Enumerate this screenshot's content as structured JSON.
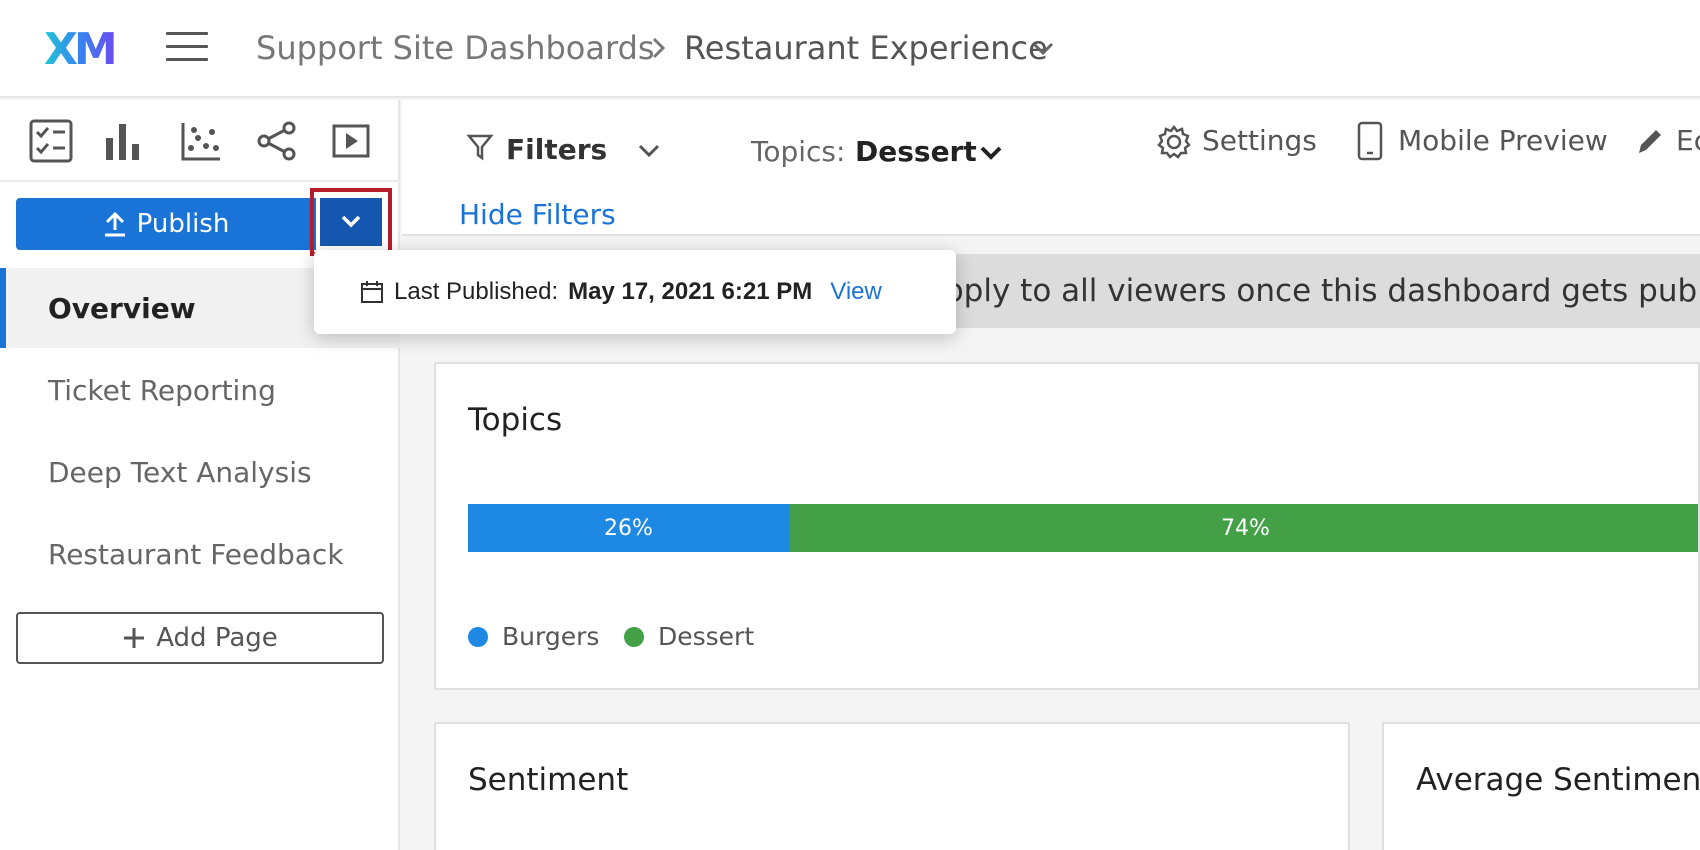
{
  "header": {
    "logo": "XM",
    "breadcrumb_root": "Support Site Dashboards",
    "breadcrumb_separator": ">",
    "breadcrumb_current": "Restaurant Experience"
  },
  "sidebar": {
    "tools": [
      {
        "icon": "checklist-icon"
      },
      {
        "icon": "bar-chart-icon"
      },
      {
        "icon": "scatter-plot-icon"
      },
      {
        "icon": "share-icon"
      },
      {
        "icon": "play-icon"
      }
    ],
    "publish_label": "Publish",
    "pages": [
      "Overview",
      "Ticket Reporting",
      "Deep Text Analysis",
      "Restaurant Feedback"
    ],
    "active_page": "Overview",
    "add_page_label": "Add Page"
  },
  "publish_popover": {
    "label": "Last Published:",
    "date": "May 17, 2021 6:21 PM",
    "view_label": "View"
  },
  "filterbar": {
    "filters_label": "Filters",
    "topics_label": "Topics:",
    "topics_value": "Dessert",
    "settings_label": "Settings",
    "mobile_preview_label": "Mobile Preview",
    "edit_label": "Ec",
    "hide_filters_label": "Hide Filters"
  },
  "notice": {
    "visible_text": "pply to all viewers once this dashboard gets publishe"
  },
  "topics_card": {
    "title": "Topics",
    "legend": [
      {
        "name": "Burgers",
        "color": "#1e88e5"
      },
      {
        "name": "Dessert",
        "color": "#43a047"
      }
    ]
  },
  "chart_data": {
    "type": "bar",
    "title": "Topics",
    "stacked": true,
    "orientation": "horizontal",
    "series": [
      {
        "name": "Burgers",
        "value": 26,
        "label": "26%",
        "color": "#1e88e5"
      },
      {
        "name": "Dessert",
        "value": 74,
        "label": "74%",
        "color": "#43a047"
      }
    ],
    "xlim": [
      0,
      100
    ]
  },
  "cards": {
    "sentiment_title": "Sentiment",
    "avg_sentiment_title": "Average Sentiment"
  },
  "colors": {
    "accent": "#1a73d6",
    "highlight_box": "#b71c2c"
  }
}
